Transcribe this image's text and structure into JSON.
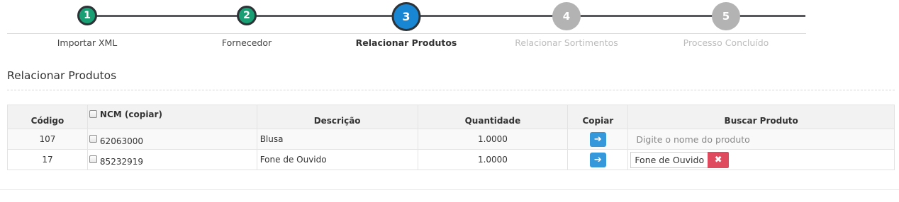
{
  "wizard": {
    "steps": [
      {
        "number": "1",
        "label": "Importar XML",
        "state": "done"
      },
      {
        "number": "2",
        "label": "Fornecedor",
        "state": "done"
      },
      {
        "number": "3",
        "label": "Relacionar Produtos",
        "state": "active"
      },
      {
        "number": "4",
        "label": "Relacionar Sortimentos",
        "state": "todo"
      },
      {
        "number": "5",
        "label": "Processo Concluído",
        "state": "todo"
      }
    ]
  },
  "section": {
    "title": "Relacionar Produtos"
  },
  "table": {
    "headers": {
      "codigo": "Código",
      "ncm": "NCM (copiar)",
      "descricao": "Descrição",
      "quantidade": "Quantidade",
      "copiar": "Copiar",
      "buscar": "Buscar Produto"
    },
    "rows": [
      {
        "codigo": "107",
        "ncm": "62063000",
        "descricao": "Blusa",
        "quantidade": "1.0000",
        "buscar_placeholder": "Digite o nome do produto"
      },
      {
        "codigo": "17",
        "ncm": "85232919",
        "descricao": "Fone de Ouvido",
        "quantidade": "1.0000",
        "produto_selecionado": "Fone de Ouvido"
      }
    ]
  },
  "icons": {
    "copy": "arrow-right-icon",
    "remove": "close-icon",
    "checkbox": "checkbox-icon"
  },
  "colors": {
    "step_done": "#1a9e73",
    "step_active": "#1986d4",
    "step_todo": "#b3b3b3",
    "copy_button": "#3498db",
    "remove_button": "#e04a5e"
  }
}
